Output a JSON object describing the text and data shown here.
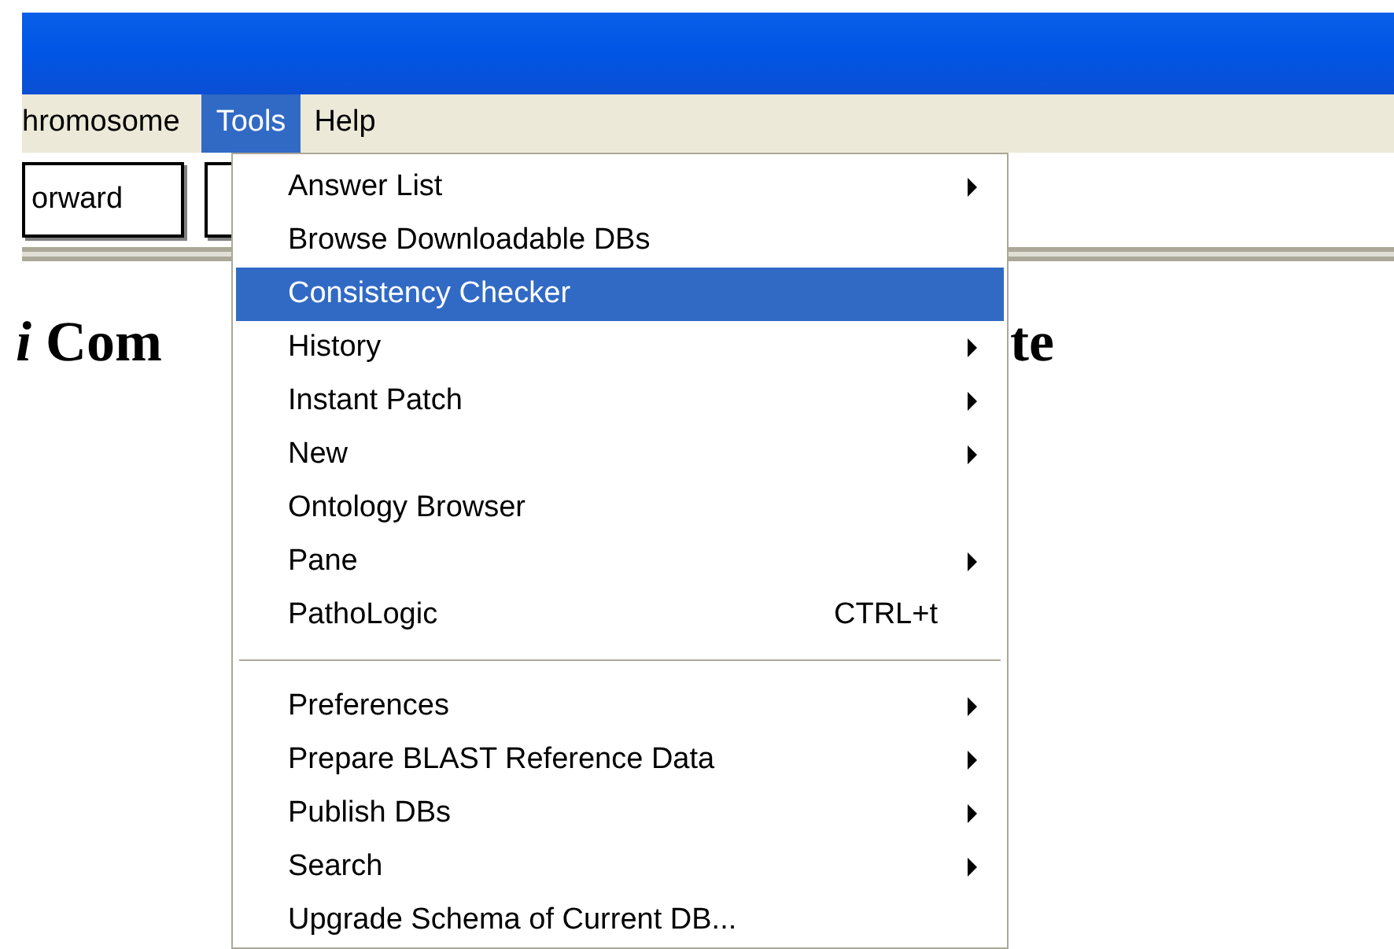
{
  "menu_bar": [
    {
      "label": "hromosome",
      "selected": false
    },
    {
      "label": "Tools",
      "selected": true
    },
    {
      "label": "Help",
      "selected": false
    }
  ],
  "toolbar": {
    "buttons": [
      {
        "kind": "labeled",
        "label": "orward"
      },
      {
        "kind": "blank"
      }
    ]
  },
  "heading": {
    "left": "*i* Com",
    "right": "te"
  },
  "tools_menu": {
    "items": [
      {
        "kind": "item",
        "label": "Answer List",
        "submenu": true,
        "selected": false
      },
      {
        "kind": "item",
        "label": "Browse Downloadable DBs",
        "submenu": false,
        "selected": false
      },
      {
        "kind": "item",
        "label": "Consistency Checker",
        "submenu": false,
        "selected": true
      },
      {
        "kind": "item",
        "label": "History",
        "submenu": true,
        "selected": false
      },
      {
        "kind": "item",
        "label": "Instant Patch",
        "submenu": true,
        "selected": false
      },
      {
        "kind": "item",
        "label": "New",
        "submenu": true,
        "selected": false
      },
      {
        "kind": "item",
        "label": "Ontology Browser",
        "submenu": false,
        "selected": false
      },
      {
        "kind": "item",
        "label": "Pane",
        "submenu": true,
        "selected": false
      },
      {
        "kind": "item",
        "label": "PathoLogic",
        "shortcut": "CTRL+t",
        "submenu": false,
        "selected": false
      },
      {
        "kind": "separator"
      },
      {
        "kind": "item",
        "label": "Preferences",
        "submenu": true,
        "selected": false
      },
      {
        "kind": "item",
        "label": "Prepare BLAST Reference Data",
        "submenu": true,
        "selected": false
      },
      {
        "kind": "item",
        "label": "Publish DBs",
        "submenu": true,
        "selected": false
      },
      {
        "kind": "item",
        "label": "Search",
        "submenu": true,
        "selected": false
      },
      {
        "kind": "item",
        "label": "Upgrade Schema of Current DB...",
        "submenu": false,
        "selected": false
      }
    ]
  }
}
